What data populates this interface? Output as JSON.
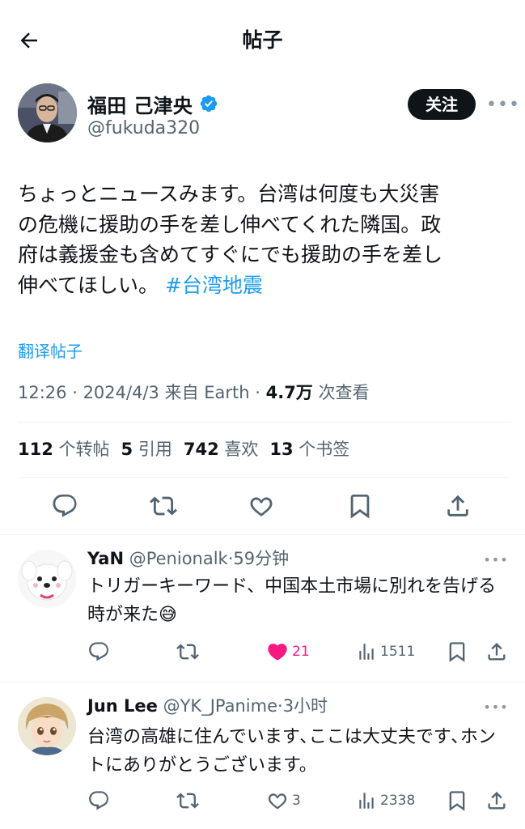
{
  "header": {
    "title": "帖子",
    "back_icon": "arrow-left-icon"
  },
  "post": {
    "author_name": "福田 己津央",
    "handle": "@fukuda320",
    "verified": true,
    "follow_label": "关注",
    "text_before": "ちょっとニュースみます。台湾は何度も大災害\nの危機に援助の手を差し伸べてくれた隣国。政\n府は義援金も含めてすぐにでも援助の手を差し\n伸べてほしい。",
    "hashtag": "#台湾地震",
    "translate_label": "翻译帖子",
    "time": "12:26",
    "date": "2024/4/3",
    "source": "来自 Earth",
    "views": "4.7万",
    "views_label": "次查看",
    "stats": {
      "reposts": "112",
      "reposts_label": "个转帖",
      "quotes": "5",
      "quotes_label": "引用",
      "likes": "742",
      "likes_label": "喜欢",
      "bookmarks": "13",
      "bookmarks_label": "个书签"
    }
  },
  "replies": [
    {
      "name": "YaN",
      "handle": "@Penionalk",
      "time": "59分钟",
      "text": "トリガーキーワード、中国本土市場に別れを告げる時が来た😅",
      "likes": "21",
      "liked": true,
      "views": "1511"
    },
    {
      "name": "Jun Lee",
      "handle": "@YK_JPanime",
      "time": "3小时",
      "text": "台湾の高雄に住んでいます､ここは大丈夫です､ホントにありがとうございます。",
      "likes": "3",
      "liked": false,
      "views": "2338"
    }
  ],
  "colors": {
    "accent": "#1d9bf0",
    "like": "#f91880",
    "text_secondary": "#536471"
  }
}
